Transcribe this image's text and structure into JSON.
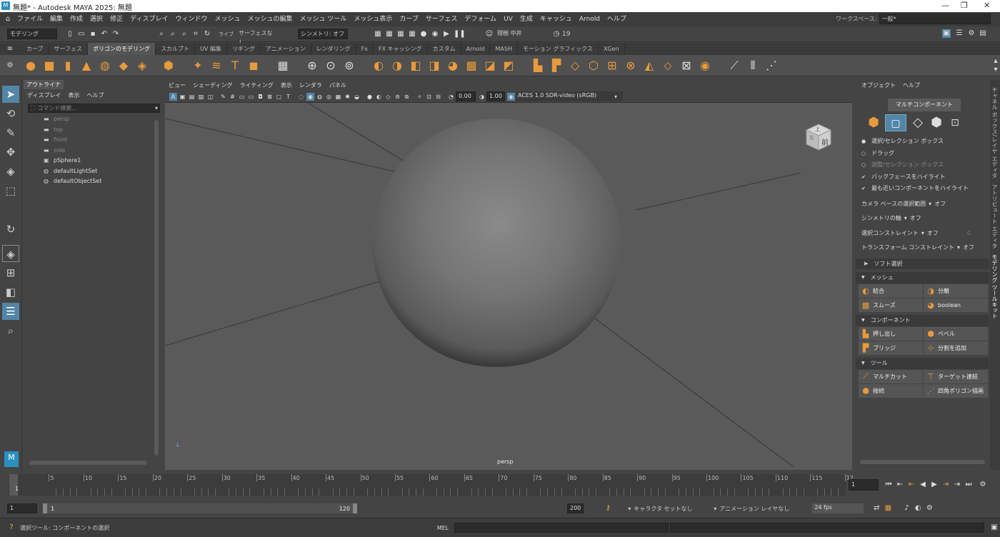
{
  "window": {
    "title": "無題* - Autodesk MAYA 2025: 無題"
  },
  "menubar": [
    "ファイル",
    "編集",
    "作成",
    "選択",
    "修正",
    "ディスプレイ",
    "ウィンドウ",
    "メッシュ",
    "メッシュの編集",
    "メッシュ ツール",
    "メッシュ表示",
    "カーブ",
    "サーフェス",
    "デフォーム",
    "UV",
    "生成",
    "キャッシュ",
    "Arnold",
    "ヘルプ"
  ],
  "workspace": {
    "label": "ワークスペース:",
    "value": "一般*"
  },
  "statusline": {
    "menuset": "モデリング",
    "live": "ライブ",
    "surface": "サーフェスなし",
    "symmetry": "シンメトリ: オフ",
    "user": "理樹 中井",
    "count": "19"
  },
  "shelf_tabs": [
    "カーブ",
    "サーフェス",
    "ポリゴンのモデリング",
    "スカルプト",
    "UV 編集",
    "リギング",
    "アニメーション",
    "レンダリング",
    "Fx",
    "FX キャッシング",
    "カスタム",
    "Arnold",
    "MASH",
    "モーション グラフィックス",
    "XGen"
  ],
  "shelf_active": "ポリゴンのモデリング",
  "outliner": {
    "tab": "アウトライナ",
    "menu": [
      "ディスプレイ",
      "表示",
      "ヘルプ"
    ],
    "search_placeholder": "コマンド検索...",
    "items": [
      {
        "label": "persp",
        "dim": true,
        "icon": "camera-icon"
      },
      {
        "label": "top",
        "dim": true,
        "icon": "camera-icon"
      },
      {
        "label": "front",
        "dim": true,
        "icon": "camera-icon"
      },
      {
        "label": "side",
        "dim": true,
        "icon": "camera-icon"
      },
      {
        "label": "pSphere1",
        "dim": false,
        "icon": "mesh-icon"
      },
      {
        "label": "defaultLightSet",
        "dim": false,
        "icon": "set-icon"
      },
      {
        "label": "defaultObjectSet",
        "dim": false,
        "icon": "set-icon"
      }
    ]
  },
  "viewport": {
    "menu": [
      "ビュー",
      "シェーディング",
      "ライティング",
      "表示",
      "レンダラ",
      "パネル"
    ],
    "exposure": "0.00",
    "gamma": "1.00",
    "colorspace": "ACES 1.0 SDR-video (sRGB)",
    "camera_label": "persp",
    "viewcube_top": "上",
    "viewcube_front": "前",
    "viewcube_left": "左"
  },
  "modeling_toolkit": {
    "menu": [
      "オブジェクト",
      "ヘルプ"
    ],
    "mode_label": "マルチコンポーネント",
    "options": [
      {
        "label": "選択/セレクション ボックス",
        "kind": "radio",
        "on": true
      },
      {
        "label": "ドラッグ",
        "kind": "radio",
        "on": false
      },
      {
        "label": "調整/セレクション ボックス",
        "kind": "radio",
        "on": false,
        "dim": true
      },
      {
        "label": "バックフェースをハイライト",
        "kind": "check",
        "on": true
      },
      {
        "label": "最も近いコンポーネントをハイライト",
        "kind": "check",
        "on": true
      }
    ],
    "settings": [
      {
        "label": "カメラ ベースの選択範囲",
        "value": "オフ"
      },
      {
        "label": "シンメトリの軸",
        "value": "オフ"
      },
      {
        "label": "選択コンストレイント",
        "value": "オフ",
        "extra": "0"
      },
      {
        "label": "トランスフォーム コンストレイント",
        "value": "オフ"
      }
    ],
    "soft_select": "ソフト選択",
    "sections": [
      {
        "title": "メッシュ",
        "buttons": [
          [
            "結合",
            "分離"
          ],
          [
            "スムーズ",
            "boolean"
          ]
        ]
      },
      {
        "title": "コンポーネント",
        "buttons": [
          [
            "押し出し",
            "ベベル"
          ],
          [
            "ブリッジ",
            "分割を追加"
          ]
        ]
      },
      {
        "title": "ツール",
        "buttons": [
          [
            "マルチカット",
            "ターゲット連結"
          ],
          [
            "接続",
            "四角ポリゴン描画"
          ]
        ]
      }
    ]
  },
  "side_tabs": [
    "チャネル ボックス/レイヤ エディタ",
    "アトリビュート エディタ",
    "モデリング ツールキット"
  ],
  "timeline": {
    "ticks": [
      "5",
      "10",
      "15",
      "20",
      "25",
      "30",
      "35",
      "40",
      "45",
      "50",
      "55",
      "60",
      "65",
      "70",
      "75",
      "80",
      "85",
      "90",
      "95",
      "100",
      "105",
      "110",
      "115",
      "12"
    ],
    "start_label": "1",
    "current": "1"
  },
  "range": {
    "start": "1",
    "inner_start": "1",
    "inner_end": "120",
    "end": "200",
    "char_set": "キャラクタ セットなし",
    "anim_layer": "アニメーション レイヤなし",
    "fps": "24 fps"
  },
  "cmdline": {
    "help": "選択ツール: コンポーネントの選択",
    "lang": "MEL"
  },
  "colors": {
    "accent": "#5285a6",
    "icon_orange": "#e89a3c",
    "bg": "#444444"
  }
}
